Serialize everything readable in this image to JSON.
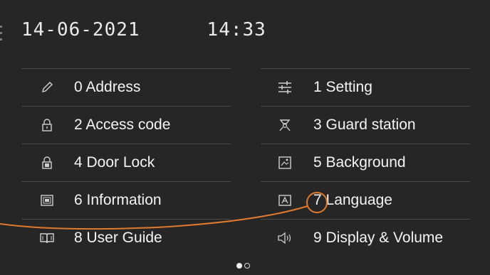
{
  "status": {
    "date": "14-06-2021",
    "time": "14:33"
  },
  "menu": {
    "left": [
      {
        "label": "0 Address",
        "icon": "pencil-icon"
      },
      {
        "label": "2 Access code",
        "icon": "padlock-icon"
      },
      {
        "label": "4 Door Lock",
        "icon": "door-lock-icon"
      },
      {
        "label": "6 Information",
        "icon": "information-icon"
      },
      {
        "label": "8 User Guide",
        "icon": "open-book-icon"
      }
    ],
    "right": [
      {
        "label": "1 Setting",
        "icon": "sliders-icon"
      },
      {
        "label": "3 Guard station",
        "icon": "guard-station-icon"
      },
      {
        "label": "5 Background",
        "icon": "picture-icon"
      },
      {
        "label": "7 Language",
        "icon": "language-icon"
      },
      {
        "label": "9 Display & Volume",
        "icon": "speaker-icon"
      }
    ]
  },
  "pagination": {
    "current_page": 1,
    "total_pages": 2
  },
  "colors": {
    "background": "#262626",
    "divider": "#4a4a4a",
    "text": "#f4f4f4",
    "annotation": "#e07a2e"
  }
}
